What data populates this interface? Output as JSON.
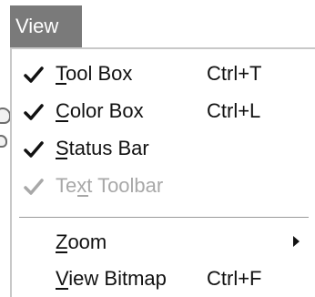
{
  "menubar": {
    "title": "View"
  },
  "menu": {
    "items": [
      {
        "label": "Tool Box",
        "shortcut": "Ctrl+T",
        "checked": true,
        "enabled": true,
        "mnemonic": "T"
      },
      {
        "label": "Color Box",
        "shortcut": "Ctrl+L",
        "checked": true,
        "enabled": true,
        "mnemonic": "C"
      },
      {
        "label": "Status Bar",
        "shortcut": "",
        "checked": true,
        "enabled": true,
        "mnemonic": "S"
      },
      {
        "label": "Text Toolbar",
        "shortcut": "",
        "checked": true,
        "enabled": false,
        "mnemonic": "x"
      },
      {
        "label": "Zoom",
        "shortcut": "",
        "checked": false,
        "enabled": true,
        "mnemonic": "Z",
        "submenu": true
      },
      {
        "label": "View Bitmap",
        "shortcut": "Ctrl+F",
        "checked": false,
        "enabled": true,
        "mnemonic": "V"
      }
    ]
  },
  "icons": {
    "check": "check-icon",
    "submenu": "submenu-arrow-icon"
  },
  "colors": {
    "menu_title_bg": "#7a7a7a",
    "menu_title_text": "#ffffff",
    "text": "#111111",
    "disabled_text": "#a8a8a8",
    "separator": "#9a9a9a"
  }
}
